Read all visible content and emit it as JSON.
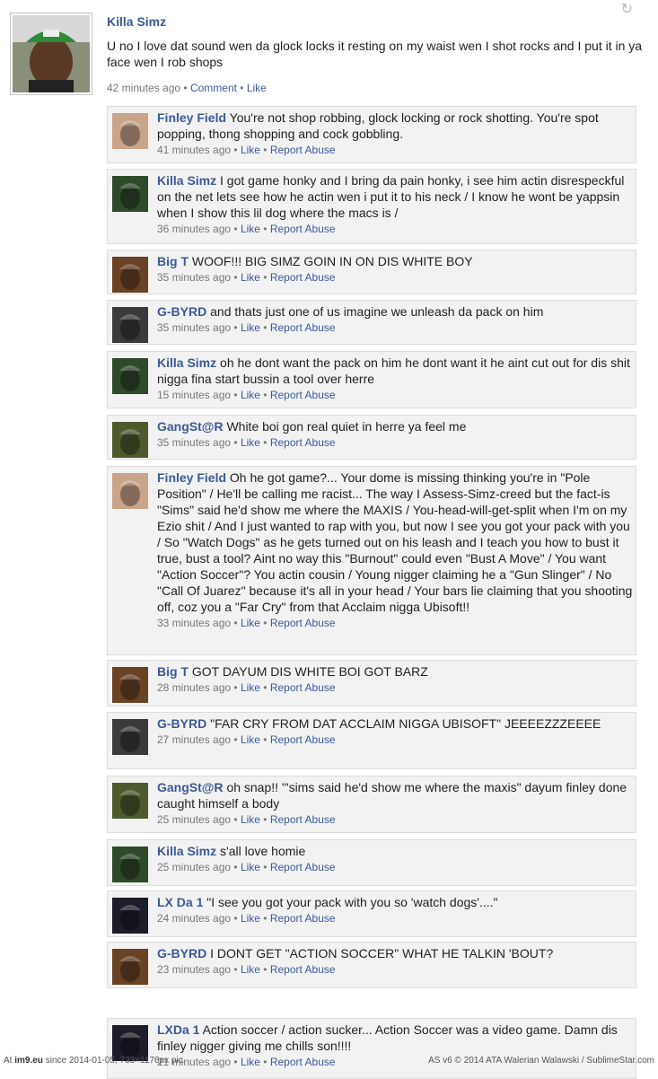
{
  "post": {
    "author": "Killa Simz",
    "text": "U no I love dat sound wen da glock locks  it resting on my waist wen I shot rocks and I put it in ya face wen I rob shops",
    "time": "42 minutes ago",
    "comment_label": "Comment",
    "like_label": "Like"
  },
  "comments": [
    {
      "author": "Finley Field",
      "text": "You're not shop robbing, glock locking or rock shotting. You're spot popping, thong shopping and cock gobbling.",
      "time": "41 minutes ago",
      "like": "Like",
      "report": "Report Abuse",
      "avatar": "#c9a48a"
    },
    {
      "author": "Killa Simz",
      "text": "I got game honky and I bring da pain honky, i see him actin disrespeckful on the net lets see how he actin wen i put it to his neck / I know he wont be yappsin when I show this lil dog where the macs is /",
      "time": "36 minutes ago",
      "like": "Like",
      "report": "Report Abuse",
      "avatar": "#2e4a2a"
    },
    {
      "author": "Big T",
      "text": "WOOF!!! BIG SIMZ GOIN IN ON DIS WHITE BOY",
      "time": "35 minutes ago",
      "like": "Like",
      "report": "Report Abuse",
      "avatar": "#6a4226"
    },
    {
      "author": "G-BYRD",
      "text": "and thats just one of us imagine we unleash da pack on him",
      "time": "35 minutes ago",
      "like": "Like",
      "report": "Report Abuse",
      "avatar": "#3a3a3a"
    },
    {
      "author": "Killa Simz",
      "text": "oh he dont want the pack on him he dont want it he aint cut out for dis shit nigga fina start bussin a tool over herre",
      "time": "15 minutes ago",
      "like": "Like",
      "report": "Report Abuse",
      "avatar": "#2e4a2a"
    },
    {
      "author": "GangSt@R",
      "text": "White boi gon real quiet in herre ya feel me",
      "time": "35 minutes ago",
      "like": "Like",
      "report": "Report Abuse",
      "avatar": "#4d5a2e"
    },
    {
      "author": "Finley Field",
      "text": "Oh he got game?... Your dome is missing thinking you're in \"Pole Position\" / He'll be calling me racist... The way I Assess-Simz-creed but the fact-is \"Sims\" said he'd show me where the MAXIS / You-head-will-get-split when I'm on my Ezio shit / And I just wanted to rap with you, but now I see you got your pack with you / So \"Watch Dogs\" as he gets turned out on his leash and I teach you how to bust it true, bust a tool? Aint no way this \"Burnout\" could even \"Bust A Move\" / You want \"Action Soccer\"? You actin cousin / Young nigger claiming he a \"Gun Slinger\" / No \"Call Of Juarez\" because it's all in your head / Your bars lie claiming that you shooting off, coz you a \"Far Cry\" from that Acclaim nigga Ubisoft!!",
      "time": "33 minutes ago",
      "like": "Like",
      "report": "Report Abuse",
      "avatar": "#c9a48a"
    },
    {
      "author": "Big T",
      "text": "  GOT DAYUM DIS WHITE BOI GOT BARZ",
      "time": "28 minutes ago",
      "like": "Like",
      "report": "Report Abuse",
      "avatar": "#6a4226"
    },
    {
      "author": "G-BYRD",
      "text": "\"FAR CRY FROM DAT ACCLAIM NIGGA UBISOFT\" JEEEEZZZEEEE",
      "time": "27 minutes ago",
      "like": "Like",
      "report": "Report Abuse",
      "avatar": "#3a3a3a"
    },
    {
      "author": "GangSt@R",
      "text": "oh snap!! '\"sims said he'd show me where the maxis\" dayum finley done caught himself a body",
      "time": "25 minutes ago",
      "like": "Like",
      "report": "Report Abuse",
      "avatar": "#4d5a2e"
    },
    {
      "author": "Killa Simz",
      "text": "s'all love homie",
      "time": "25 minutes ago",
      "like": "Like",
      "report": "Report Abuse",
      "avatar": "#2e4a2a"
    },
    {
      "author": "LX Da 1",
      "text": "\"I see you got your pack with you so 'watch dogs'....\"",
      "time": "24 minutes ago",
      "like": "Like",
      "report": "Report Abuse",
      "avatar": "#1c1c2a"
    },
    {
      "author": "G-BYRD",
      "text": "I DONT GET \"ACTION SOCCER\" WHAT HE TALKIN 'BOUT?",
      "time": "23 minutes ago",
      "like": "Like",
      "report": "Report Abuse",
      "avatar": "#6a4226"
    },
    {
      "author": "LXDa 1",
      "text": "Action soccer / action sucker... Action Soccer was a video game. Damn dis finley nigger giving me chills son!!!!",
      "time": "21 minutes ago",
      "like": "Like",
      "report": "Report Abuse",
      "avatar": "#1c1c2a"
    }
  ],
  "footer": {
    "left_prefix": "At ",
    "site": "im9.eu",
    "left_rest": " since 2014-01-05, 733×1176px pic.",
    "right": "AS v6 © 2014 ATA Walerian Walawski / SublimeStar.com"
  }
}
